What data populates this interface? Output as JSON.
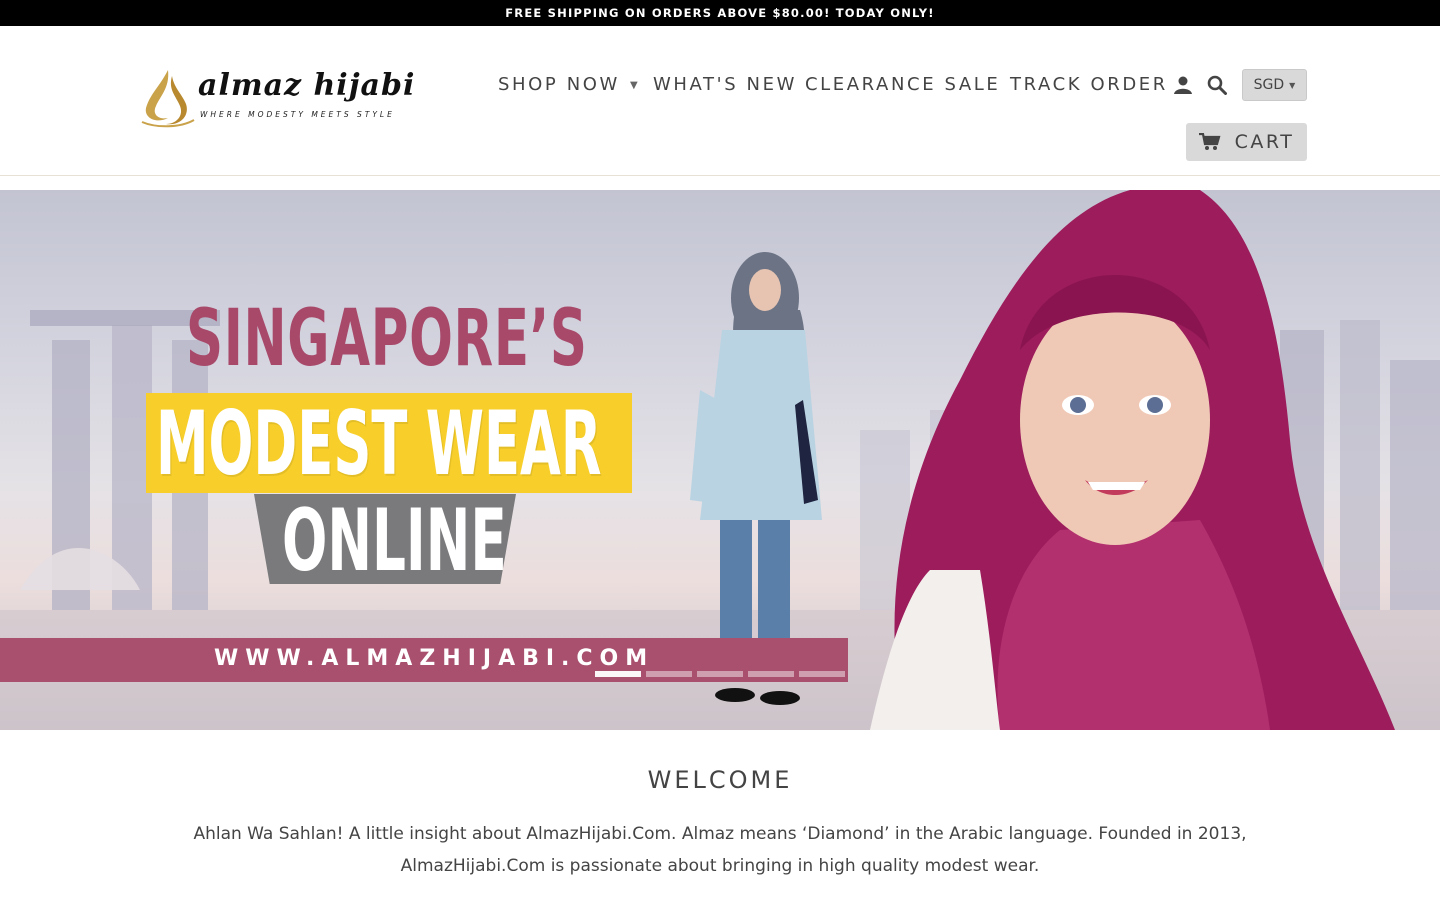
{
  "announcement": {
    "text": "FREE SHIPPING ON ORDERS ABOVE $80.00! TODAY ONLY!"
  },
  "brand": {
    "name": "almaz hijabi",
    "tagline": "WHERE MODESTY MEETS STYLE"
  },
  "nav": {
    "items": [
      {
        "label": "SHOP NOW",
        "has_dropdown": true
      },
      {
        "label": "WHAT'S NEW"
      },
      {
        "label": "CLEARANCE SALE"
      },
      {
        "label": "TRACK ORDER"
      }
    ],
    "account_icon": "user-icon",
    "search_icon": "search-icon",
    "currency": "SGD",
    "cart_label": "CART",
    "cart_icon": "cart-icon"
  },
  "hero": {
    "line1": "SINGAPORE’S",
    "line2": "MODEST WEAR",
    "line3": "ONLINE",
    "url": "WWW.ALMAZHIJABI.COM",
    "slide_count": 5,
    "active_slide": 1,
    "colors": {
      "accent": "#a8496a",
      "yellow": "#f8cf2a",
      "grey": "#7a7a7c",
      "hijab_pink": "#9c1c5c"
    }
  },
  "welcome": {
    "title": "WELCOME",
    "text": "Ahlan Wa Sahlan! A little insight about AlmazHijabi.Com. Almaz means ‘Diamond’ in the Arabic language. Founded in 2013, AlmazHijabi.Com is passionate about bringing in high quality modest wear."
  }
}
